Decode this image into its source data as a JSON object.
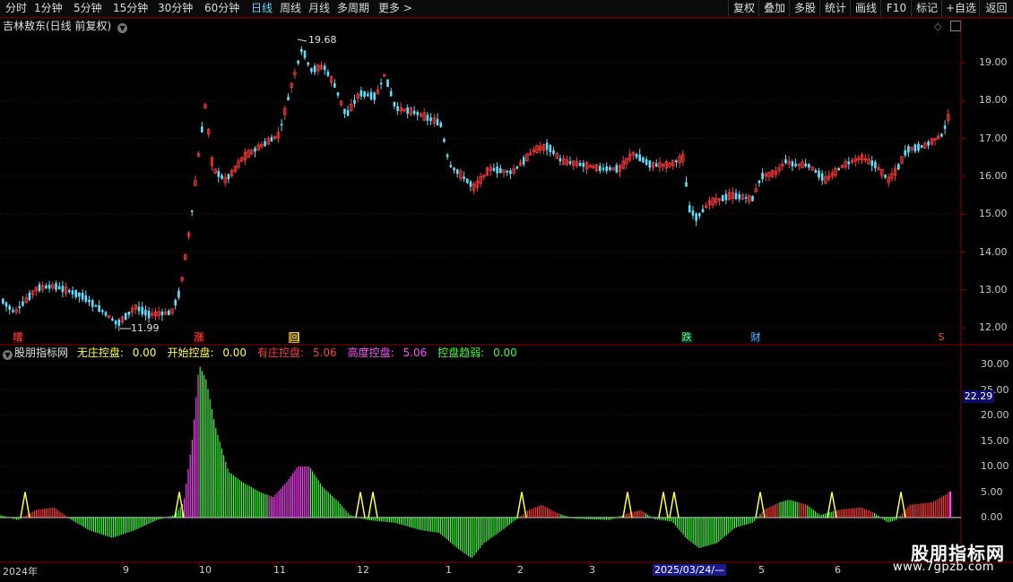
{
  "toolbar": {
    "periods": [
      "分时",
      "1分钟",
      "5分钟",
      "15分钟",
      "30分钟",
      "60分钟",
      "日线",
      "周线",
      "月线",
      "多周期",
      "更多 >"
    ],
    "active_period": "日线",
    "right_buttons": [
      "复权",
      "叠加",
      "多股",
      "统计",
      "画线",
      "F10",
      "标记",
      "+自选",
      "返回"
    ]
  },
  "main_chart": {
    "stock_name": "吉林敖东(日线 前复权)",
    "price_axis_ticks": [
      "19.00",
      "18.00",
      "17.00",
      "16.00",
      "15.00",
      "14.00",
      "13.00",
      "12.00"
    ],
    "high_label": "19.68",
    "low_label": "11.99",
    "event_markers": [
      {
        "text": "增",
        "color": "#ff4a4a"
      },
      {
        "text": "涨",
        "color": "#ff4a4a"
      },
      {
        "text": "回",
        "color": "#ffd24a"
      },
      {
        "text": "跌",
        "color": "#5aff6a"
      },
      {
        "text": "财",
        "color": "#56b6ff"
      },
      {
        "text": "S",
        "color": "#ff4a4a"
      }
    ]
  },
  "indicator": {
    "name": "股朋指标网",
    "legend": [
      {
        "label": "无庄控盘:",
        "value": "0.00",
        "color": "#ffff3c"
      },
      {
        "label": "开始控盘:",
        "value": "0.00",
        "color": "#ffff3c"
      },
      {
        "label": "有庄控盘:",
        "value": "5.06",
        "color": "#ff3a3a"
      },
      {
        "label": "高度控盘:",
        "value": "5.06",
        "color": "#ff4cff"
      },
      {
        "label": "控盘趋弱:",
        "value": "0.00",
        "color": "#3cff3c"
      }
    ],
    "axis_ticks": [
      "30.00",
      "25.00",
      "20.00",
      "15.00",
      "10.00",
      "5.00",
      "0.00"
    ],
    "current_value": "22.29"
  },
  "time_axis": [
    "2024年",
    "9",
    "10",
    "11",
    "12",
    "1",
    "2",
    "3",
    "2025/03/24/—",
    "5",
    "6"
  ],
  "watermark": {
    "title": "股朋指标网",
    "url": "www.7gpzb.com"
  },
  "colors": {
    "up": "#ff3a3a",
    "down": "#5ee0ff",
    "grid": "#5a0000",
    "axis": "#8a0000"
  }
}
